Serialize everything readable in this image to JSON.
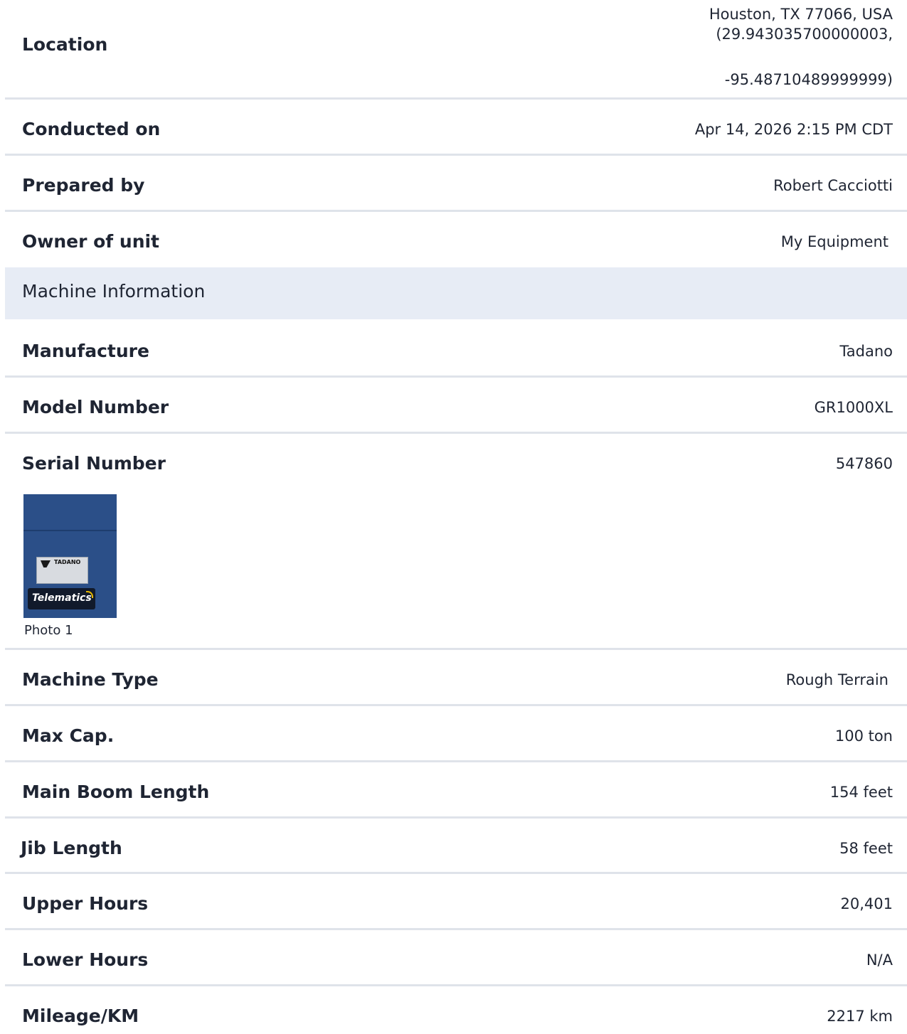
{
  "summary": {
    "location": {
      "label": "Location",
      "line1": "Houston, TX 77066, USA",
      "line2": "(29.943035700000003,",
      "line3": "-95.48710489999999)"
    },
    "conducted_on": {
      "label": "Conducted on",
      "value": "Apr 14, 2026 2:15 PM CDT"
    },
    "prepared_by": {
      "label": "Prepared by",
      "value": "Robert Cacciotti"
    },
    "owner": {
      "label": "Owner of unit",
      "value": "My Equipment"
    }
  },
  "machine_section": {
    "title": "Machine Information",
    "manufacture": {
      "label": "Manufacture",
      "value": "Tadano"
    },
    "model_number": {
      "label": "Model Number",
      "value": "GR1000XL"
    },
    "serial_number": {
      "label": "Serial Number",
      "value": "547860",
      "photo": {
        "caption": "Photo 1",
        "plate_brand": "TADANO",
        "badge_text": "Telematics"
      }
    },
    "machine_type": {
      "label": "Machine Type",
      "value": "Rough Terrain"
    },
    "max_cap": {
      "label": "Max Cap.",
      "value": "100 ton"
    },
    "main_boom_length": {
      "label": "Main Boom Length",
      "value": "154 feet"
    },
    "jib_length": {
      "label": "Jib Length",
      "value": "58 feet"
    },
    "upper_hours": {
      "label": "Upper Hours",
      "value": "20,401"
    },
    "lower_hours": {
      "label": "Lower Hours",
      "value": "N/A"
    },
    "mileage": {
      "label": "Mileage/KM",
      "value": "2217 km"
    }
  }
}
